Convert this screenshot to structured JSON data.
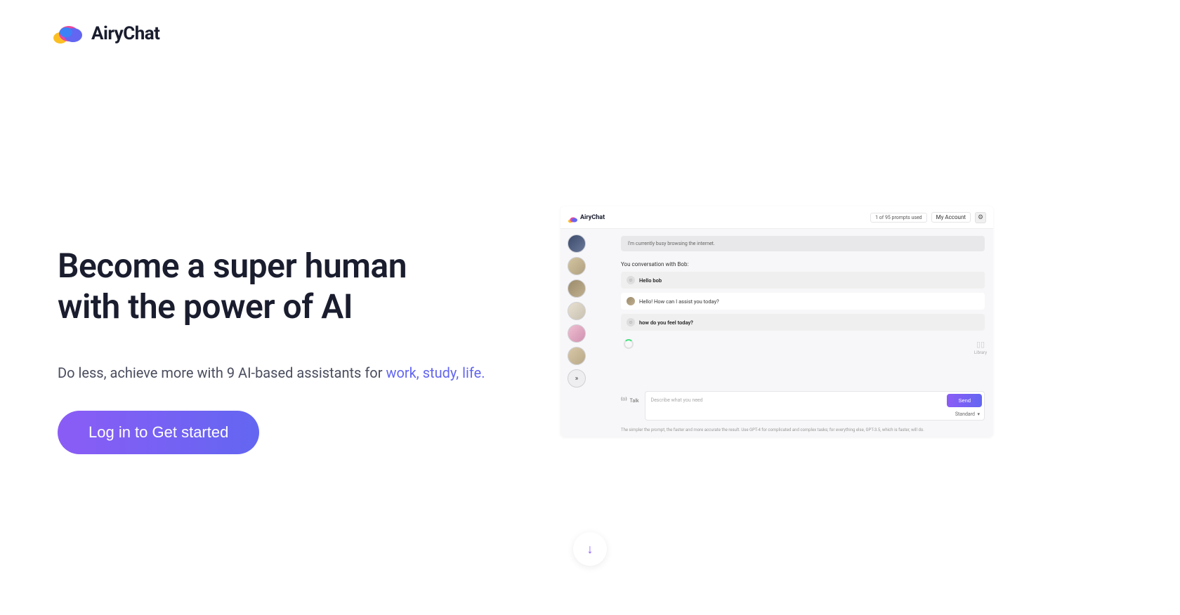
{
  "brand": {
    "name": "AiryChat",
    "colors": {
      "primary": "#6366f1",
      "gradient_start": "#8b5cf6",
      "gradient_end": "#6366f1"
    }
  },
  "hero": {
    "title_line1": "Become a super human",
    "title_line2": "with the power of AI",
    "subtitle_prefix": "Do less, achieve more with 9 AI-based assistants for ",
    "subtitle_highlight": "work, study, life.",
    "cta_label": "Log in to Get started"
  },
  "preview": {
    "header": {
      "brand": "AiryChat",
      "prompts_used": "1 of 95 prompts used",
      "account_label": "My Account"
    },
    "status_bar": "I'm currently busy browsing the internet.",
    "conversation_label": "You conversation with Bob:",
    "messages": [
      {
        "role": "user",
        "text": "Hello bob"
      },
      {
        "role": "bot",
        "text": "Hello! How can I assist you today?"
      },
      {
        "role": "user",
        "text": "how do you feel today?"
      }
    ],
    "input": {
      "talk_label": "Talk",
      "placeholder": "Describe what you need",
      "send_label": "Send",
      "model_label": "Standard"
    },
    "footer_note": "The simpler the prompt, the faster and more accurate the result. Use GPT-4 for complicated and complex tasks; for everything else, GPT-3.5, which is faster, will do.",
    "library_label": "Library"
  },
  "scroll_hint": {
    "icon": "arrow-down"
  }
}
